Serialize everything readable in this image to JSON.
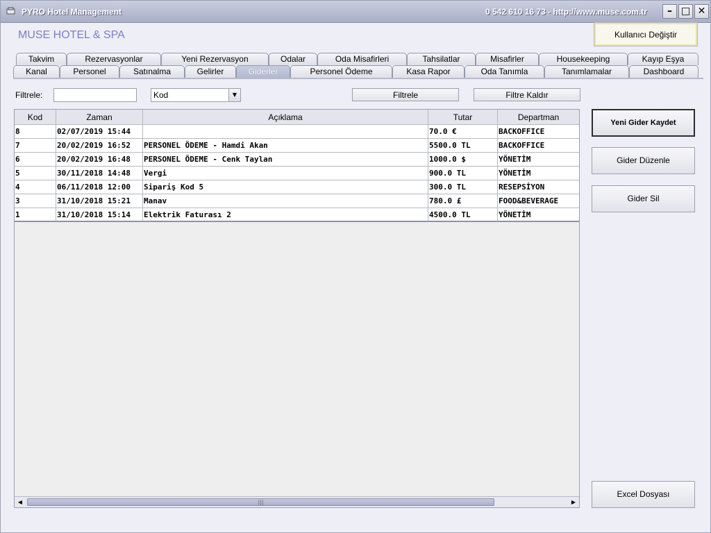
{
  "window": {
    "title": "PYRO Hotel Management",
    "contact": "0 542 610 16 73  -  http://www.muse.com.tr",
    "minimize_icon": "minimize-icon",
    "maximize_icon": "maximize-icon",
    "close_icon": "close-icon",
    "min_glyph": "–",
    "max_glyph": "□",
    "close_glyph": "✕"
  },
  "header": {
    "hotel_name": "MUSE HOTEL & SPA",
    "user_switch_label": "Kullanıcı Değiştir"
  },
  "tabs": {
    "row1": [
      "Takvim",
      "Rezervasyonlar",
      "Yeni Rezervasyon",
      "Odalar",
      "Oda Misafirleri",
      "Tahsilatlar",
      "Misafirler",
      "Housekeeping",
      "Kayıp Eşya"
    ],
    "row2": [
      "Kanal",
      "Personel",
      "Satınalma",
      "Gelirler",
      "Giderler",
      "Personel Ödeme",
      "Kasa Rapor",
      "Oda Tanımla",
      "Tanımlamalar",
      "Dashboard"
    ],
    "active": "Giderler"
  },
  "filter": {
    "label": "Filtrele:",
    "input_value": "",
    "select_value": "Kod",
    "filter_button": "Filtrele",
    "remove_filter_button": "Filtre Kaldır"
  },
  "table": {
    "columns": [
      "Kod",
      "Zaman",
      "Açıklama",
      "Tutar",
      "Departman"
    ],
    "rows": [
      [
        "8",
        "02/07/2019 15:44",
        "",
        "70.0 €",
        "BACKOFFICE"
      ],
      [
        "7",
        "20/02/2019 16:52",
        "PERSONEL ÖDEME - Hamdi Akan",
        "5500.0 TL",
        "BACKOFFICE"
      ],
      [
        "6",
        "20/02/2019 16:48",
        "PERSONEL ÖDEME - Cenk Taylan",
        "1000.0 $",
        "YÖNETİM"
      ],
      [
        "5",
        "30/11/2018 14:48",
        "Vergi",
        "900.0 TL",
        "YÖNETİM"
      ],
      [
        "4",
        "06/11/2018 12:00",
        "Sipariş Kod 5",
        "300.0 TL",
        "RESEPSİYON"
      ],
      [
        "3",
        "31/10/2018 15:21",
        "Manav",
        "780.0 £",
        "FOOD&BEVERAGE"
      ],
      [
        "1",
        "31/10/2018 15:14",
        "Elektrik Faturası 2",
        "4500.0 TL",
        "YÖNETİM"
      ]
    ]
  },
  "actions": {
    "new_expense": "Yeni Gider Kaydet",
    "edit_expense": "Gider Düzenle",
    "delete_expense": "Gider Sil",
    "excel": "Excel Dosyası"
  }
}
